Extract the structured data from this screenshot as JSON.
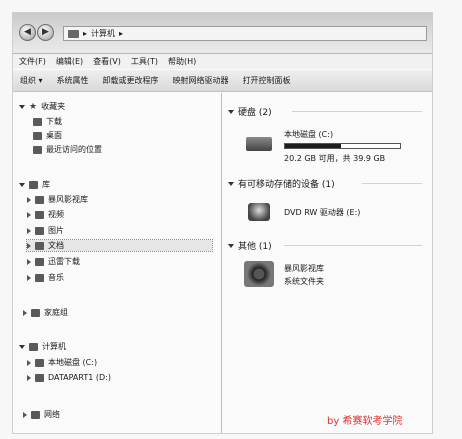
{
  "address": {
    "path_sep": "▸",
    "location": "计算机",
    "sep2": "▸"
  },
  "menu": [
    "文件(F)",
    "编辑(E)",
    "查看(V)",
    "工具(T)",
    "帮助(H)"
  ],
  "toolbar": [
    "组织 ▾",
    "系统属性",
    "卸载或更改程序",
    "映射网络驱动器",
    "打开控制面板"
  ],
  "nav": {
    "favorites": {
      "label": "收藏夹",
      "items": [
        "下载",
        "桌面",
        "最近访问的位置"
      ]
    },
    "libraries": {
      "label": "库",
      "items": [
        "暴风影视库",
        "视频",
        "图片",
        "文档",
        "迅雷下载",
        "音乐"
      ]
    },
    "homegroup": "家庭组",
    "computer": {
      "label": "计算机",
      "items": [
        "本地磁盘 (C:)",
        "DATAPART1 (D:)"
      ]
    },
    "network": "网络"
  },
  "content": {
    "hard_disk": {
      "header": "硬盘 (2)",
      "drive_name": "本地磁盘 (C:)",
      "usage_fraction": 0.49,
      "free_text": "20.2 GB 可用，共 39.9 GB"
    },
    "removable": {
      "header": "有可移动存储的设备 (1)",
      "drive_name": "DVD RW 驱动器 (E:)"
    },
    "other": {
      "header": "其他 (1)",
      "item_name": "暴风影视库",
      "item_type": "系统文件夹"
    }
  },
  "watermark": "by 希赛软考学院"
}
